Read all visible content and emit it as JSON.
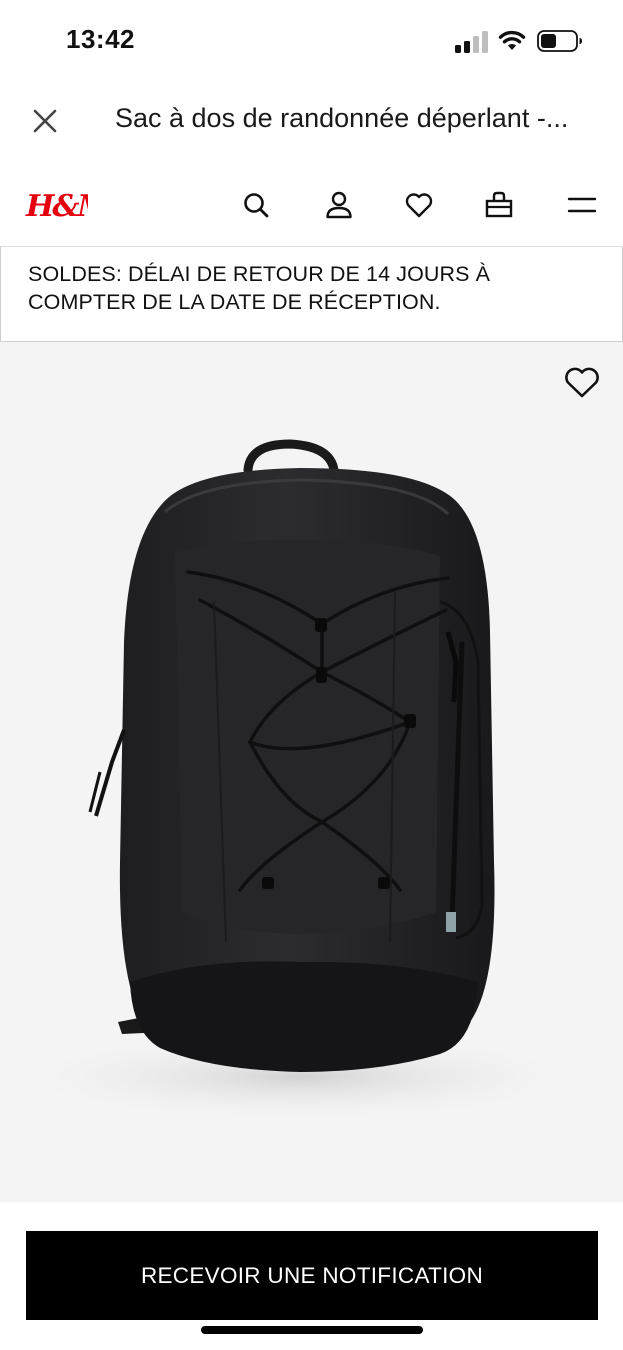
{
  "status_bar": {
    "time": "13:42",
    "icons": [
      "cellular-signal-icon",
      "wifi-icon",
      "battery-icon"
    ]
  },
  "browser": {
    "close_icon": "close-icon",
    "page_title": "Sac à dos de randonnée déperlant -..."
  },
  "header": {
    "logo_text": "H&M",
    "brand_color": "#e50010",
    "icons": [
      "search-icon",
      "account-icon",
      "heart-icon",
      "shopping-bag-icon",
      "menu-icon"
    ]
  },
  "promo": {
    "line1": "SOLDES: DÉLAI DE RETOUR DE 14 JOURS À",
    "line2": "COMPTER DE LA DATE DE RÉCEPTION."
  },
  "product": {
    "wishlist_icon": "heart-outline-icon",
    "image": "black-backpack-image",
    "background_color": "#f4f4f4"
  },
  "cta": {
    "label": "RECEVOIR UNE NOTIFICATION"
  }
}
